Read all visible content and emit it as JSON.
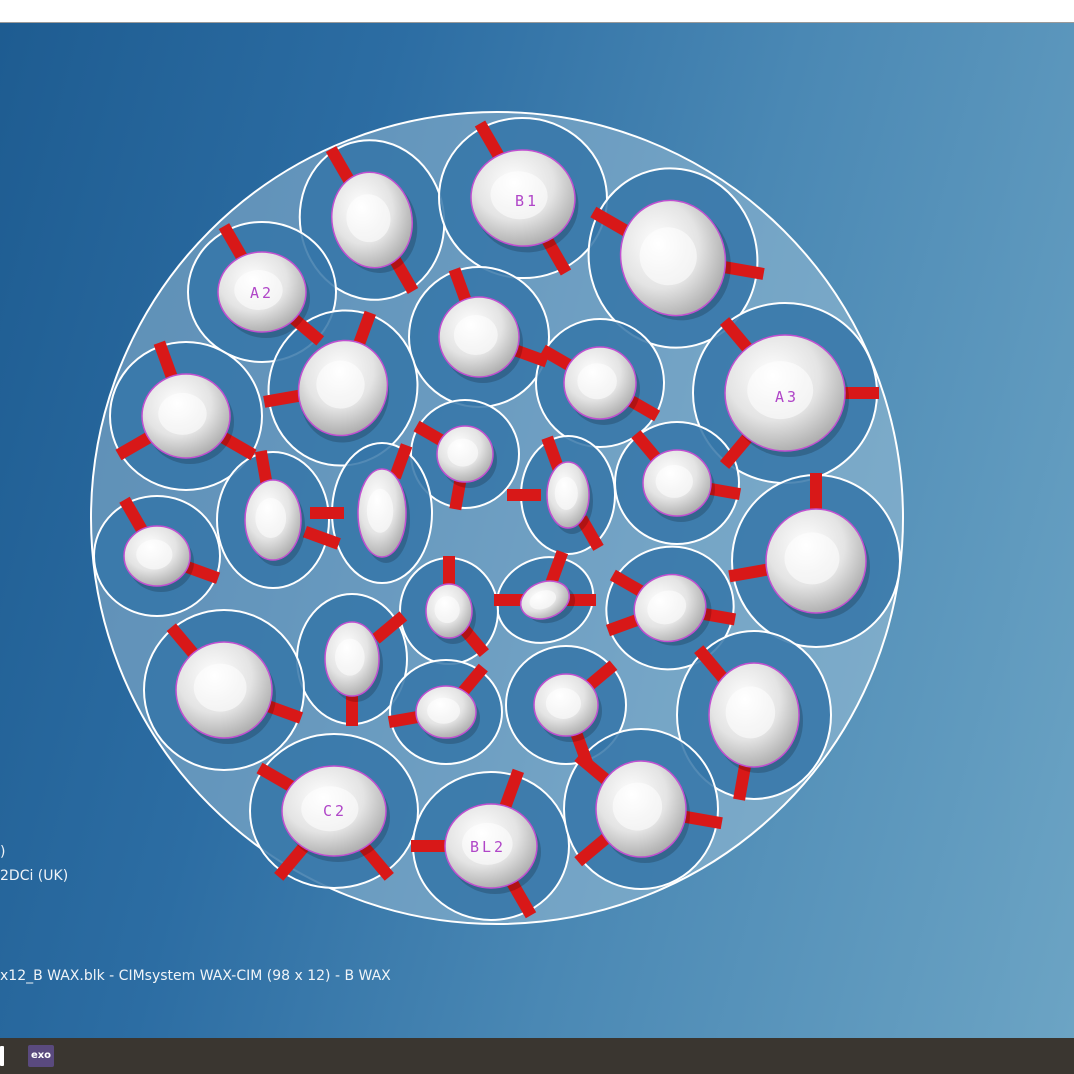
{
  "viewport": {
    "project_lines": [
      "(UK)",
      "2DCi (UK)"
    ],
    "project_line_visible": [
      ")",
      "2DCi (UK)"
    ],
    "block_file": "x12_B WAX.blk - CIMsystem WAX-CIM (98 x 12) - B WAX"
  },
  "nest": {
    "shade_labels": [
      "B1",
      "A2",
      "A3",
      "C2",
      "BL2"
    ]
  },
  "taskbar": {
    "app_label": "exo"
  },
  "colors": {
    "background_start": "#1e5c91",
    "background_end": "#6ca4c4",
    "sprue": "#d81818",
    "outline": "#c050d0",
    "tooth": "#e6e6e6",
    "pocket": "#3576a8"
  }
}
